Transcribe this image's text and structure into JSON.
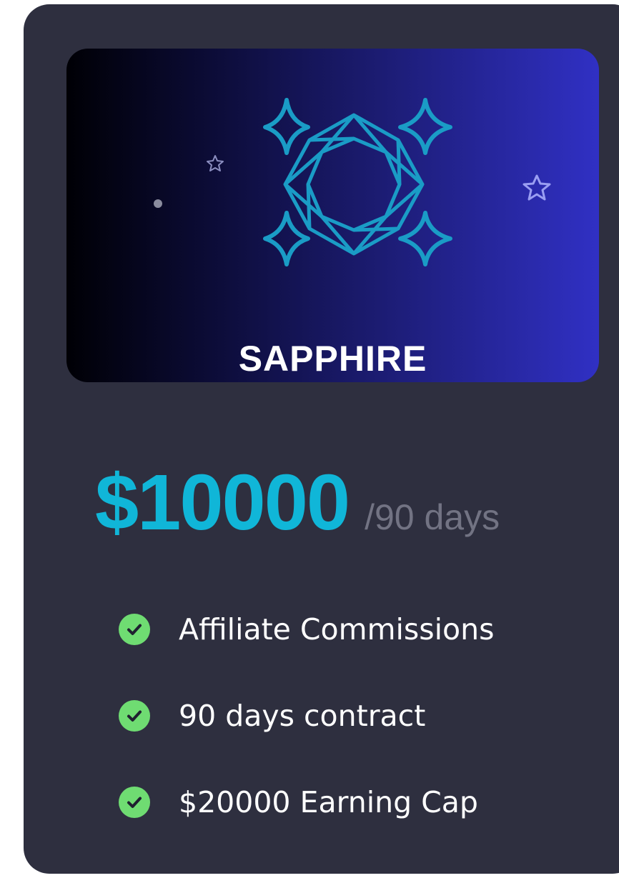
{
  "plan": {
    "name": "SAPPHIRE",
    "price": "$10000",
    "period": "/90 days"
  },
  "features": [
    {
      "text": "Affiliate Commissions",
      "icon": "check-circle-icon"
    },
    {
      "text": "90 days contract",
      "icon": "check-circle-icon"
    },
    {
      "text": "$20000 Earning Cap",
      "icon": "check-circle-icon"
    }
  ],
  "icons": {
    "emblem": "sapphire-gem-icon",
    "decorations": [
      "sparkle-icon",
      "star-outline-icon",
      "dot-icon"
    ]
  },
  "colors": {
    "card_background": "#2e2f3f",
    "banner_gradient_start": "#000005",
    "banner_gradient_end": "#3030c4",
    "gem_stroke": "#1a9cc6",
    "price": "#10b6d8",
    "period": "#727383",
    "check": "#6fdc72",
    "text": "#ffffff"
  }
}
